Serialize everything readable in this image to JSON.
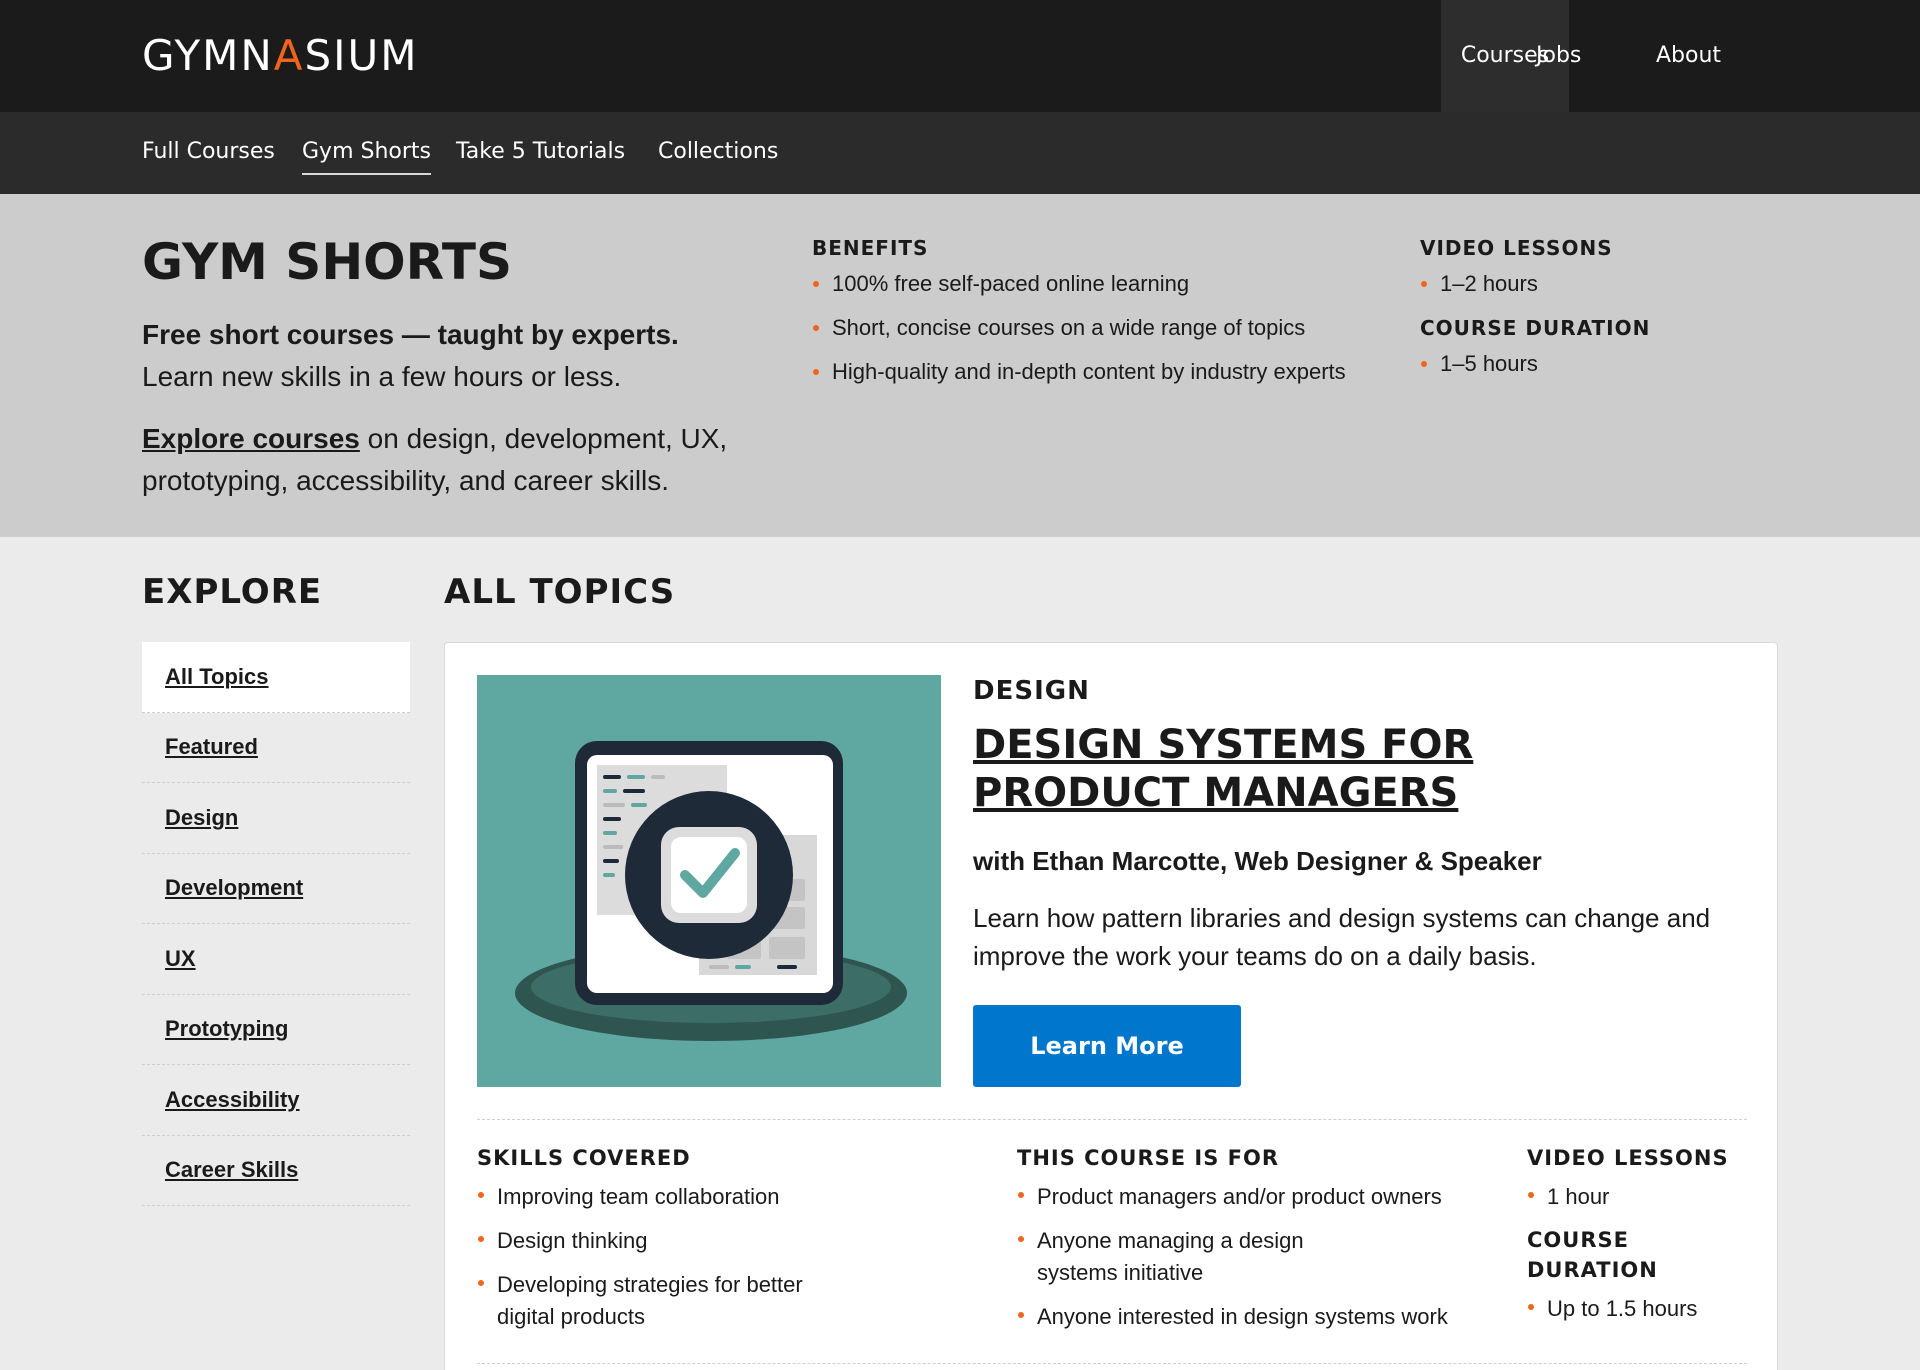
{
  "header": {
    "logo_prefix": "GYMN",
    "logo_accent": "A",
    "logo_suffix": "SIUM",
    "nav": {
      "courses": "Courses",
      "jobs": "Jobs",
      "about": "About"
    }
  },
  "subnav": {
    "full_courses": "Full Courses",
    "gym_shorts": "Gym Shorts",
    "take5": "Take 5 Tutorials",
    "collections": "Collections"
  },
  "hero": {
    "title": "GYM SHORTS",
    "tagline_bold": "Free short courses — taught by experts.",
    "tagline_rest": "Learn new skills in a few hours or less.",
    "explore_link": "Explore courses",
    "explore_rest": " on design, development, UX, prototyping, accessibility, and career skills.",
    "benefits": {
      "heading": "BENEFITS",
      "items": [
        "100% free self-paced online learning",
        "Short, concise courses on a wide range of topics",
        "High-quality and in-depth content by industry experts"
      ]
    },
    "video_lessons": {
      "heading": "VIDEO LESSONS",
      "value": "1–2 hours"
    },
    "course_duration": {
      "heading": "COURSE DURATION",
      "value": "1–5 hours"
    }
  },
  "explore": {
    "title": "EXPLORE",
    "items": [
      "All Topics",
      "Featured",
      "Design",
      "Development",
      "UX",
      "Prototyping",
      "Accessibility",
      "Career Skills"
    ]
  },
  "topics": {
    "title": "ALL TOPICS",
    "card": {
      "category": "DESIGN",
      "title": "DESIGN SYSTEMS FOR PRODUCT MANAGERS",
      "author": "with Ethan Marcotte, Web Designer & Speaker",
      "description": "Learn how pattern libraries and design systems can change and improve the work your teams do on a daily basis.",
      "button": "Learn More",
      "skills": {
        "heading": "SKILLS COVERED",
        "items": [
          "Improving team collaboration",
          "Design thinking",
          "Developing strategies for better digital products"
        ]
      },
      "audience": {
        "heading": "THIS COURSE IS FOR",
        "items": [
          "Product managers and/or product owners",
          "Anyone managing a design systems initiative",
          "Anyone interested in design systems work"
        ]
      },
      "video_lessons": {
        "heading": "VIDEO LESSONS",
        "value": "1 hour"
      },
      "course_duration": {
        "heading": "COURSE DURATION",
        "value": "Up to 1.5 hours"
      }
    }
  },
  "colors": {
    "accent_orange": "#f0641e",
    "button_blue": "#0077cc",
    "header_bg": "#1b1b1b",
    "hero_bg": "#cccccc",
    "card_image_teal": "#5fa7a1"
  }
}
